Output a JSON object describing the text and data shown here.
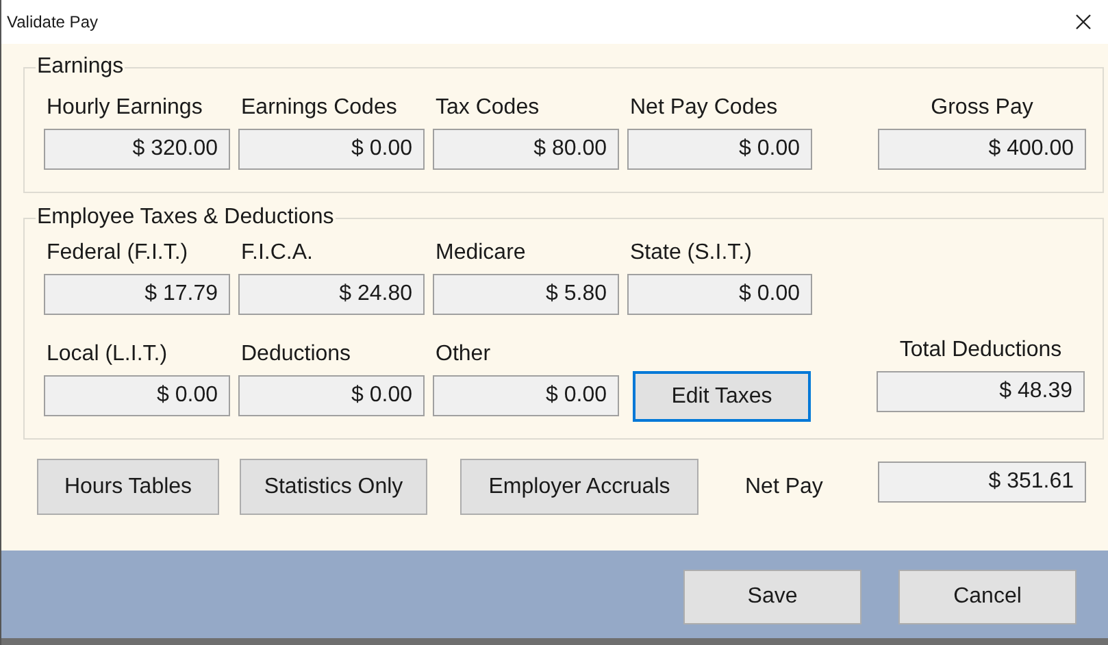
{
  "window": {
    "title": "Validate Pay"
  },
  "earnings": {
    "legend": "Earnings",
    "fields": [
      {
        "label": "Hourly Earnings",
        "value": "$ 320.00"
      },
      {
        "label": "Earnings Codes",
        "value": "$ 0.00"
      },
      {
        "label": "Tax Codes",
        "value": "$ 80.00"
      },
      {
        "label": "Net Pay Codes",
        "value": "$ 0.00"
      }
    ],
    "gross": {
      "label": "Gross Pay",
      "value": "$ 400.00"
    }
  },
  "taxes": {
    "legend": "Employee Taxes & Deductions",
    "rows": [
      [
        {
          "label": "Federal (F.I.T.)",
          "value": "$ 17.79"
        },
        {
          "label": "F.I.C.A.",
          "value": "$ 24.80"
        },
        {
          "label": "Medicare",
          "value": "$ 5.80"
        },
        {
          "label": "State (S.I.T.)",
          "value": "$ 0.00"
        }
      ],
      [
        {
          "label": "Local (L.I.T.)",
          "value": "$ 0.00"
        },
        {
          "label": "Deductions",
          "value": "$ 0.00"
        },
        {
          "label": "Other",
          "value": "$ 0.00"
        }
      ]
    ],
    "edit_button": {
      "label": "Edit Taxes",
      "focused": true
    },
    "total": {
      "label": "Total Deductions",
      "value": "$ 48.39"
    }
  },
  "actions": [
    "Hours Tables",
    "Statistics Only",
    "Employer Accruals"
  ],
  "net_pay": {
    "label": "Net Pay",
    "value": "$ 351.61"
  },
  "footer_buttons": [
    "Save",
    "Cancel"
  ]
}
